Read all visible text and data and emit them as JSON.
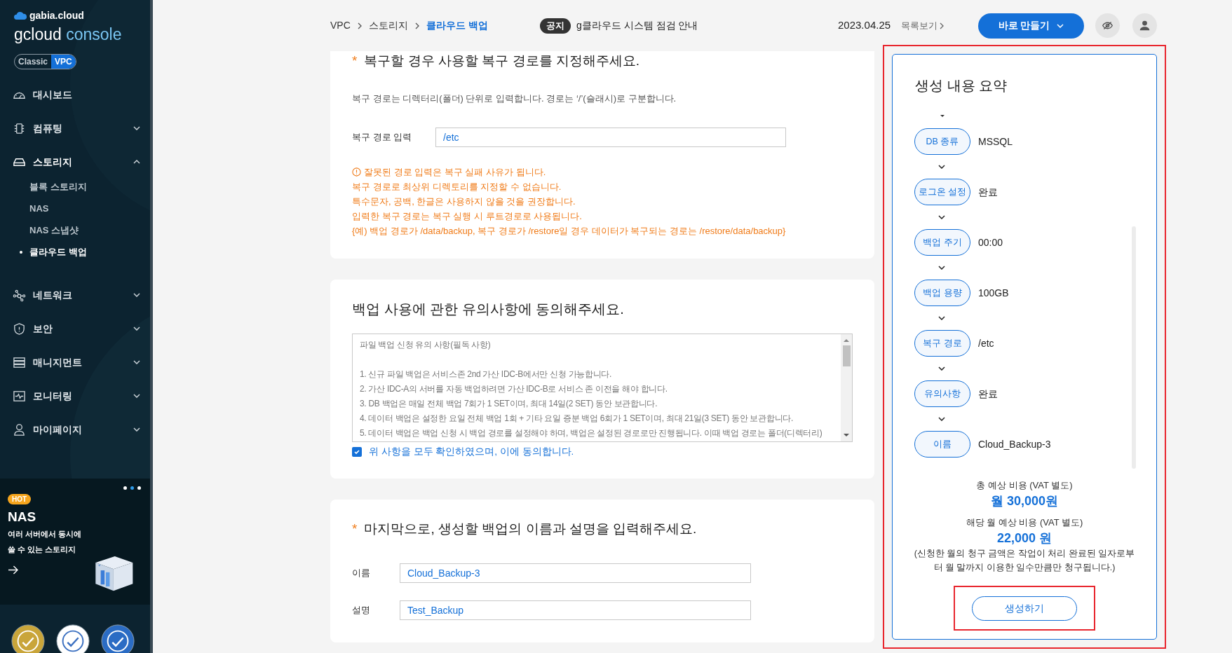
{
  "sidebar": {
    "brand": "gabia.cloud",
    "product_prefix": "gcloud",
    "product_suffix": "console",
    "env_toggle": [
      {
        "label": "Classic",
        "selected": false
      },
      {
        "label": "VPC",
        "selected": true
      }
    ],
    "items": [
      {
        "label": "대시보드",
        "kind": "link"
      },
      {
        "label": "컴퓨팅",
        "kind": "group",
        "expanded": false
      },
      {
        "label": "스토리지",
        "kind": "group",
        "expanded": true,
        "children": [
          {
            "label": "블록 스토리지",
            "selected": false
          },
          {
            "label": "NAS",
            "selected": false
          },
          {
            "label": "NAS 스냅샷",
            "selected": false
          },
          {
            "label": "클라우드 백업",
            "selected": true
          }
        ]
      },
      {
        "label": "네트워크",
        "kind": "group",
        "expanded": false
      },
      {
        "label": "보안",
        "kind": "group",
        "expanded": false
      },
      {
        "label": "매니지먼트",
        "kind": "group",
        "expanded": false
      },
      {
        "label": "모니터링",
        "kind": "group",
        "expanded": false
      },
      {
        "label": "마이페이지",
        "kind": "group",
        "expanded": false
      }
    ],
    "promo": {
      "slides": [
        {
          "selected": false
        },
        {
          "selected": true
        },
        {
          "selected": false
        }
      ],
      "tag": "HOT",
      "title": "NAS",
      "description": "여러 서버에서 동시에\n쓸 수 있는 스토리지"
    }
  },
  "header": {
    "breadcrumb": [
      {
        "label": "VPC",
        "current": false
      },
      {
        "label": "스토리지",
        "current": false
      },
      {
        "label": "클라우드 백업",
        "current": true
      }
    ],
    "notice": {
      "tag": "공지",
      "text": "g클라우드 시스템 점검 안내"
    },
    "date": "2023.04.25",
    "list_link": "목록보기",
    "create_button": "바로 만들기"
  },
  "restore_path": {
    "required_mark": "*",
    "title": "복구할 경우 사용할 복구 경로를 지정해주세요.",
    "description": "복구 경로는 디렉터리(폴더) 단위로 입력합니다. 경로는 ‘/’(슬래시)로 구분합니다.",
    "field_label": "복구 경로 입력",
    "field_value": "/etc",
    "warnings": [
      "잘못된 경로 입력은 복구 실패 사유가 됩니다.",
      "복구 경로로 최상위 디렉토리를 지정할 수 없습니다.",
      "특수문자, 공백, 한글은 사용하지 않을 것을 권장합니다.",
      "입력한 복구 경로는 복구 실행 시 루트경로로 사용됩니다.",
      "{예) 백업 경로가 /data/backup, 복구 경로가 /restore일 경우 데이터가 복구되는 경로는 /restore/data/backup}"
    ]
  },
  "agreement": {
    "title": "백업 사용에 관한 유의사항에 동의해주세요.",
    "terms": [
      "파일 백업 신청 유의 사항(필독 사항)",
      "1. 신규 파일 백업은 서비스존 2nd 가산 IDC-B에서만 신청 가능합니다.",
      "2. 가산 IDC-A의 서버를 자동 백업하려면 가산 IDC-B로 서비스 존 이전을 해야 합니다.",
      "3. DB 백업은 매일 전체 백업 7회가 1 SET이며, 최대 14일(2 SET) 동안 보관합니다.",
      "4. 데이터 백업은 설정한 요일 전체 백업 1회 + 기타 요일 증분 백업 6회가 1 SET이며, 최대 21일(3 SET) 동안 보관합니다.",
      "5. 데이터 백업은 백업 신청 시 백업 경로를 설정해야 하며, 백업은 설정된 경로로만 진행됩니다. 이때 백업 경로는 폴더(디렉터리)"
    ],
    "consent_label": "위 사항을 모두 확인하였으며, 이에 동의합니다.",
    "checked": true
  },
  "naming": {
    "required_mark": "*",
    "title": "마지막으로, 생성할 백업의 이름과 설명을 입력해주세요.",
    "fields": [
      {
        "label": "이름",
        "value": "Cloud_Backup-3"
      },
      {
        "label": "설명",
        "value": "Test_Backup"
      }
    ]
  },
  "summary": {
    "title": "생성 내용 요약",
    "steps": [
      {
        "label": "DB 종류",
        "value": "MSSQL"
      },
      {
        "label": "로그온 설정",
        "value": "완료"
      },
      {
        "label": "백업 주기",
        "value": "00:00"
      },
      {
        "label": "백업 용량",
        "value": "100GB"
      },
      {
        "label": "복구 경로",
        "value": "/etc"
      },
      {
        "label": "유의사항",
        "value": "완료"
      },
      {
        "label": "이름",
        "value": "Cloud_Backup-3"
      }
    ],
    "total_label": "총 예상 비용 (VAT 별도)",
    "total_value": "월 30,000원",
    "month_label": "해당 월 예상 비용 (VAT 별도)",
    "month_value": "22,000 원",
    "note": "(신청한 월의 청구 금액은 작업이 처리 완료된 일자로부터 월 말까지 이용한 일수만큼만 청구됩니다.)",
    "submit": "생성하기"
  }
}
